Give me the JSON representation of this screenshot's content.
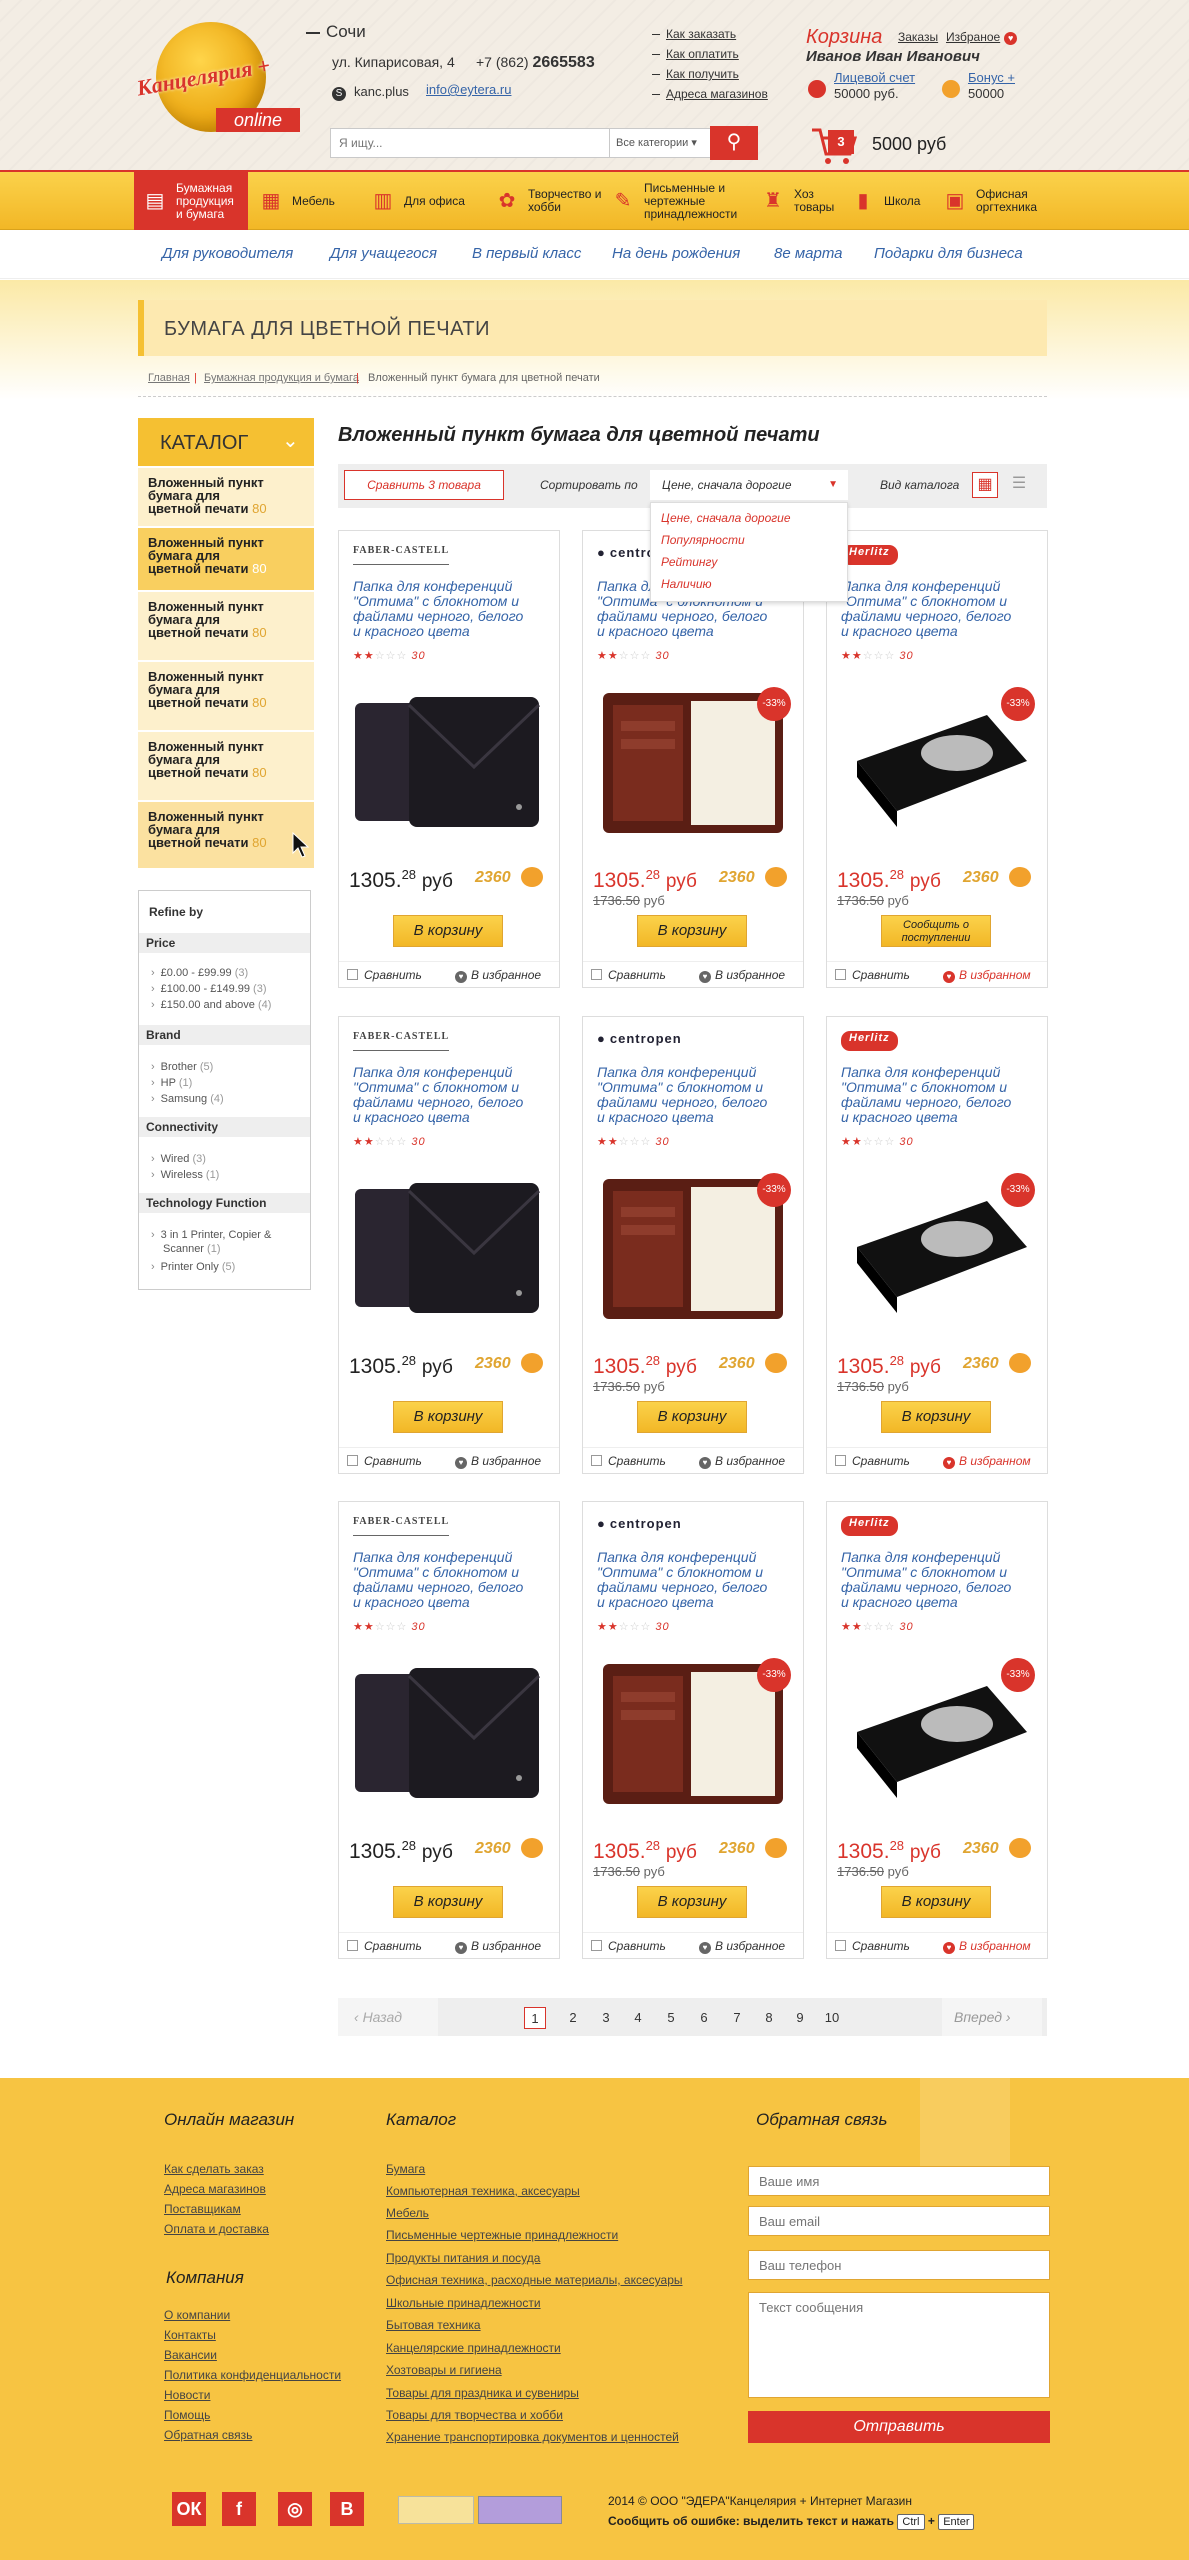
{
  "header": {
    "logo_text": "Канцелярия +",
    "logo_online": "online",
    "city": "Сочи",
    "address": "ул. Кипарисовая, 4",
    "phone_prefix": "+7 (862)",
    "phone_number": "2665583",
    "skype": "kanc.plus",
    "email": "info@eytera.ru",
    "top_links": [
      "Как заказать",
      "Как оплатить",
      "Как получить",
      "Адреса магазинов"
    ],
    "cart_title": "Корзина",
    "orders_link": "Заказы",
    "favorites_link": "Избраное",
    "user_name": "Иванов Иван Иванович",
    "personal_account_label": "Лицевой счет",
    "personal_account_value": "50000 руб.",
    "bonus_label": "Бонус +",
    "bonus_value": "50000",
    "search_placeholder": "Я ищу...",
    "category_select": "Все категории",
    "cart_count": "3",
    "cart_sum": "5000 руб"
  },
  "nav": [
    {
      "label": "Бумажная продукция и бумага",
      "icon": "paper-icon"
    },
    {
      "label": "Мебель",
      "icon": "furniture-icon"
    },
    {
      "label": "Для офиса",
      "icon": "office-icon"
    },
    {
      "label": "Творчество и хобби",
      "icon": "palette-icon"
    },
    {
      "label": "Письменные и чертежные принадлежности",
      "icon": "pencil-icon"
    },
    {
      "label": "Хоз товары",
      "icon": "household-icon"
    },
    {
      "label": "Школа",
      "icon": "school-icon"
    },
    {
      "label": "Офисная оргтехника",
      "icon": "printer-icon"
    }
  ],
  "subnav": [
    "Для руководителя",
    "Для учащегося",
    "В первый класс",
    "На день рождения",
    "8е марта",
    "Подарки для бизнеса"
  ],
  "page_title": "БУМАГА ДЛЯ ЦВЕТНОЙ ПЕЧАТИ",
  "breadcrumb": [
    "Главная",
    "Бумажная продукция и бумага",
    "Вложенный пункт бумага для цветной печати"
  ],
  "sidebar": {
    "catalog_title": "КАТАЛОГ",
    "items": [
      {
        "l1": "Вложенный пункт",
        "l2": "бумага для",
        "l3": "цветной печати",
        "count": "80"
      },
      {
        "l1": "Вложенный пункт",
        "l2": "бумага для",
        "l3": "цветной печати",
        "count": "80"
      },
      {
        "l1": "Вложенный пункт",
        "l2": "бумага для",
        "l3": "цветной печати",
        "count": "80"
      },
      {
        "l1": "Вложенный пункт",
        "l2": "бумага для",
        "l3": "цветной печати",
        "count": "80"
      },
      {
        "l1": "Вложенный пункт",
        "l2": "бумага для",
        "l3": "цветной печати",
        "count": "80"
      },
      {
        "l1": "Вложенный пункт",
        "l2": "бумага для",
        "l3": "цветной печати",
        "count": "80"
      }
    ],
    "refine_title": "Refine by",
    "price_title": "Price",
    "price": [
      [
        "£0.00 - £99.99",
        "(3)"
      ],
      [
        "£100.00 - £149.99",
        "(3)"
      ],
      [
        "£150.00 and above",
        "(4)"
      ]
    ],
    "brand_title": "Brand",
    "brand": [
      [
        "Brother",
        "(5)"
      ],
      [
        "HP",
        "(1)"
      ],
      [
        "Samsung",
        "(4)"
      ]
    ],
    "conn_title": "Connectivity",
    "conn": [
      [
        "Wired",
        "(3)"
      ],
      [
        "Wireless",
        "(1)"
      ]
    ],
    "tech_title": "Technology Function",
    "tech1": "3 in 1 Printer, Copier &",
    "tech2": "Scanner",
    "tech2c": "(1)",
    "tech3": "Printer Only",
    "tech3c": "(5)"
  },
  "content": {
    "title": "Вложенный пункт бумага для цветной печати",
    "compare_button": "Сравнить  3 товара",
    "sort_label": "Сортировать по",
    "sort_value": "Цене, сначала дорогие",
    "sort_options": [
      "Цене, сначала дорогие",
      "Популярности",
      "Рейтингу",
      "Наличию"
    ],
    "view_label": "Вид каталога"
  },
  "card_common": {
    "name_l1": "Папка для конференций",
    "name_l2": "\"Оптима\" с блокнотом и",
    "name_l3": "файлами черного, белого",
    "name_l4": "и красного цвета",
    "rating_count": "30",
    "price_int": "1305.",
    "price_dec": "28",
    "currency": "руб",
    "old_price": "1736.50",
    "old_currency": "руб",
    "bonus": "2360",
    "discount": "-33%",
    "buy": "В корзину",
    "notify": "Сообщить о поступлении",
    "compare": "Сравнить",
    "fav": "В избранное",
    "fav_on": "В избранном"
  },
  "brands": [
    "FABER-CASTELL",
    "centropen",
    "Herlitz"
  ],
  "pager": {
    "prev": "Назад",
    "next": "Вперед",
    "pages": [
      "1",
      "2",
      "3",
      "4",
      "5",
      "6",
      "7",
      "8",
      "9",
      "10"
    ]
  },
  "footer": {
    "shop_title": "Онлайн магазин",
    "shop_links": [
      "Как сделать заказ",
      "Адреса магазинов",
      "Поставщикам",
      "Оплата и доставка"
    ],
    "company_title": "Компания",
    "company_links": [
      "О компании",
      "Контакты",
      "Вакансии",
      "Политика конфиденциальности",
      "Новости",
      "Помощь",
      "Обратная связь"
    ],
    "catalog_title": "Каталог",
    "catalog_links": [
      "Бумага",
      "Компьютерная техника, аксесуары",
      "Мебель",
      "Письменные чертежные принадлежности",
      "Продукты питания и посуда",
      "Офисная техника, расходные материалы, аксесуары",
      "Школьные принадлежности",
      "Бытовая техника",
      "Канцелярские принадлежности",
      "Хозтовары и гигиена",
      "Товары для праздника и сувениры",
      "Товары для творчества и хобби",
      "Хранение транспортировка документов и ценностей"
    ],
    "feedback_title": "Обратная связь",
    "name_ph": "Ваше имя",
    "email_ph": "Ваш email",
    "phone_ph": "Ваш телефон",
    "msg_ph": "Текст сообщения",
    "send": "Отправить",
    "social": [
      "ОК",
      "f",
      "◎",
      "В"
    ],
    "copyright": "2014 © ООО \"ЭДЕРА\"Канцелярия + Интернет Магазин",
    "error_text": "Сообщить об ошибке: выделить текст и нажать",
    "key1": "Ctrl",
    "key2": "Enter"
  }
}
